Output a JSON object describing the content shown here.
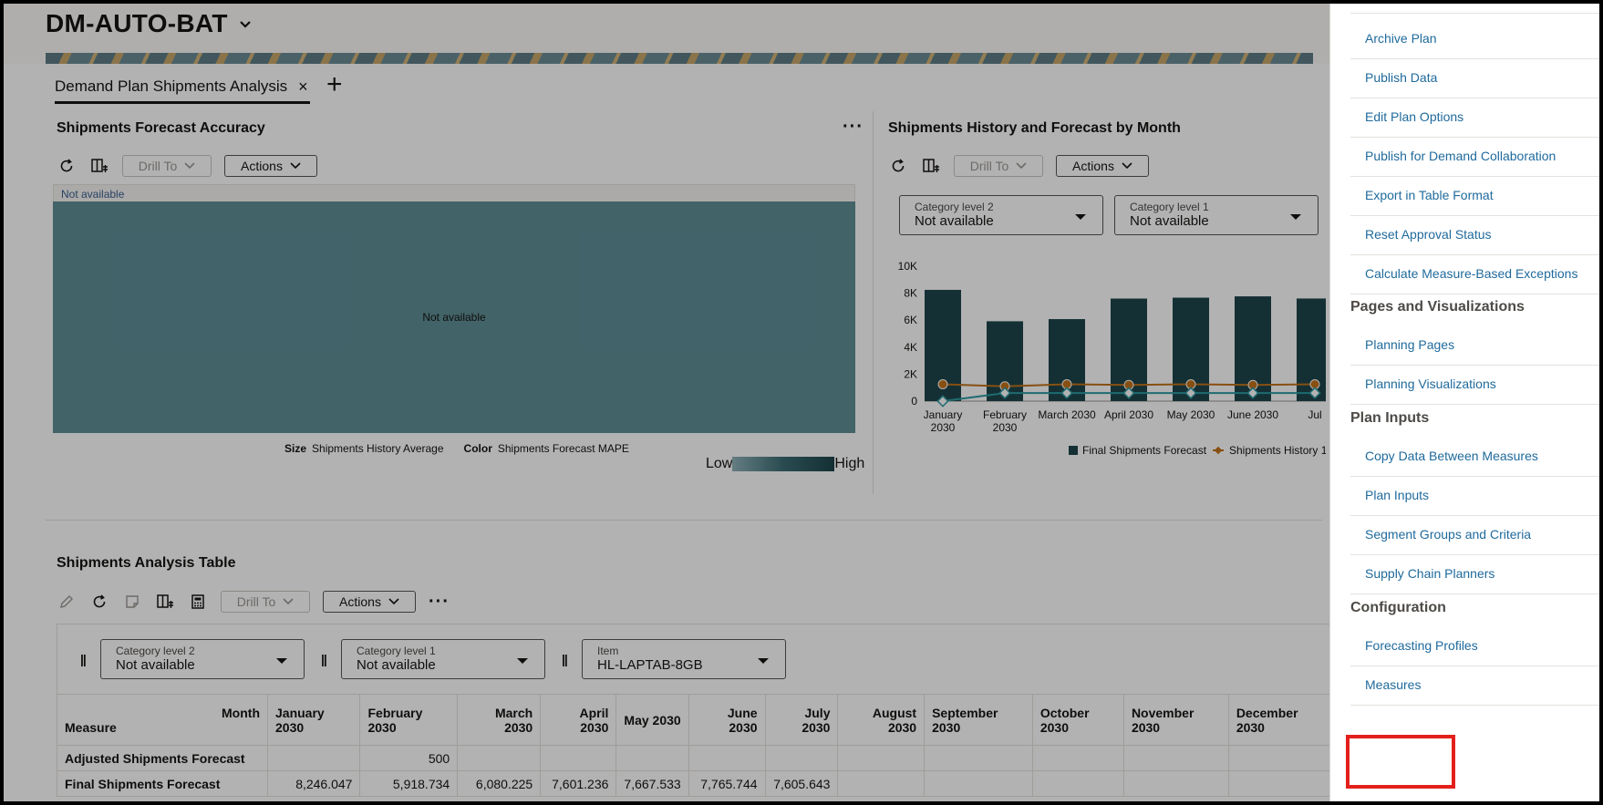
{
  "header": {
    "title": "DM-AUTO-BAT"
  },
  "tabs": {
    "active": "Demand Plan Shipments Analysis",
    "close": "×",
    "add": "+"
  },
  "accuracy_panel": {
    "title": "Shipments Forecast Accuracy",
    "drill_to": "Drill To",
    "actions": "Actions",
    "more": "···",
    "top_label": "Not available",
    "center_label": "Not available",
    "size_key": "Size",
    "size_value": "Shipments History Average",
    "color_key": "Color",
    "color_value": "Shipments Forecast MAPE",
    "low": "Low",
    "high": "High"
  },
  "history_panel": {
    "title": "Shipments History and Forecast by Month",
    "drill_to": "Drill To",
    "actions": "Actions",
    "filter1_label": "Category level 2",
    "filter1_value": "Not available",
    "filter2_label": "Category level 1",
    "filter2_value": "Not available"
  },
  "chart_data": {
    "type": "bar",
    "categories": [
      "January 2030",
      "February 2030",
      "March 2030",
      "April 2030",
      "May 2030",
      "June 2030",
      "Jul"
    ],
    "x_tick_lines": [
      [
        "January",
        "2030"
      ],
      [
        "February",
        "2030"
      ],
      [
        "March 2030"
      ],
      [
        "April 2030"
      ],
      [
        "May 2030"
      ],
      [
        "June 2030"
      ],
      [
        "Jul"
      ]
    ],
    "y_ticks": [
      "10K",
      "8K",
      "6K",
      "4K",
      "2K",
      "0"
    ],
    "ylim": [
      0,
      10000
    ],
    "series": [
      {
        "name": "Final Shipments Forecast",
        "kind": "bar",
        "color": "#1d454b",
        "values": [
          8246,
          5919,
          6080,
          7601,
          7668,
          7766,
          7606
        ]
      },
      {
        "name": "Shipments History 1",
        "kind": "line",
        "color": "#c2731a",
        "values": [
          1250,
          1100,
          1250,
          1200,
          1250,
          1200,
          1250
        ]
      },
      {
        "name": "",
        "kind": "line",
        "color": "#2d9aa3",
        "values": [
          0,
          600,
          600,
          600,
          600,
          600,
          600
        ]
      }
    ]
  },
  "table_panel": {
    "title": "Shipments Analysis Table",
    "drill_to": "Drill To",
    "actions": "Actions",
    "more": "···",
    "filter1_label": "Category level 2",
    "filter1_value": "Not available",
    "filter2_label": "Category level 1",
    "filter2_value": "Not available",
    "filter3_label": "Item",
    "filter3_value": "HL-LAPTAB-8GB",
    "corner_top": "Month",
    "corner_bottom": "Measure",
    "columns": [
      "January 2030",
      "February 2030",
      "March 2030",
      "April 2030",
      "May 2030",
      "June 2030",
      "July 2030",
      "August 2030",
      "September 2030",
      "October 2030",
      "November 2030",
      "December 2030"
    ],
    "rows": [
      {
        "label": "Adjusted Shipments Forecast",
        "values": [
          "",
          "500",
          "",
          "",
          "",
          "",
          "",
          "",
          "",
          "",
          "",
          ""
        ]
      },
      {
        "label": "Final Shipments Forecast",
        "values": [
          "8,246.047",
          "5,918.734",
          "6,080.225",
          "7,601.236",
          "7,667.533",
          "7,765.744",
          "7,605.643",
          "",
          "",
          "",
          "",
          ""
        ]
      }
    ]
  },
  "drawer": {
    "items_top": [
      "Archive Plan",
      "Publish Data",
      "Edit Plan Options",
      "Publish for Demand Collaboration",
      "Export in Table Format",
      "Reset Approval Status",
      "Calculate Measure-Based Exceptions"
    ],
    "section_pages": "Pages and Visualizations",
    "items_pages": [
      "Planning Pages",
      "Planning Visualizations"
    ],
    "section_inputs": "Plan Inputs",
    "items_inputs": [
      "Copy Data Between Measures",
      "Plan Inputs",
      "Segment Groups and Criteria",
      "Supply Chain Planners"
    ],
    "section_config": "Configuration",
    "items_config": [
      "Forecasting Profiles",
      "Measures"
    ]
  }
}
